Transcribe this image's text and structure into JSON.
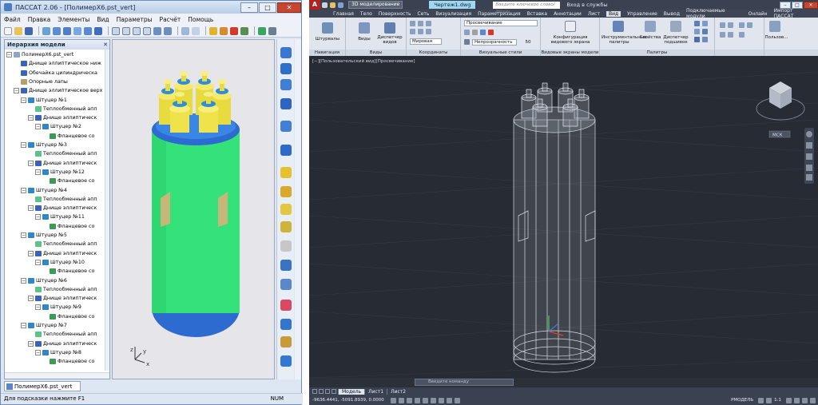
{
  "passat": {
    "title": "ПАССАТ 2.06 - [ПолимерХ6.pst_vert]",
    "menu": [
      "Файл",
      "Правка",
      "Элементы",
      "Вид",
      "Параметры",
      "Расчёт",
      "Помощь"
    ],
    "tree_title": "Иерархия модели",
    "tree": [
      {
        "label": "ПолимерХ6.pst_vert",
        "level": 0,
        "toggle": "−",
        "icon": "#8aa5c8"
      },
      {
        "label": "Днище эллиптическое ниж",
        "level": 1,
        "toggle": "",
        "icon": "#3a63b5"
      },
      {
        "label": "Обечайка цилиндрическа",
        "level": 1,
        "toggle": "",
        "icon": "#3a63b5"
      },
      {
        "label": "Опорные лапы",
        "level": 1,
        "toggle": "",
        "icon": "#b0a070"
      },
      {
        "label": "Днище эллиптическое верх",
        "level": 1,
        "toggle": "−",
        "icon": "#3a63b5"
      },
      {
        "label": "Штуцер №1",
        "level": 2,
        "toggle": "−",
        "icon": "#2f86c9"
      },
      {
        "label": "Теплообменный апп",
        "level": 3,
        "toggle": "",
        "icon": "#5cc28a"
      },
      {
        "label": "Днище эллиптическ",
        "level": 3,
        "toggle": "−",
        "icon": "#3a63b5"
      },
      {
        "label": "Штуцер №2",
        "level": 4,
        "toggle": "−",
        "icon": "#2f86c9"
      },
      {
        "label": "Фланцевое со",
        "level": 5,
        "toggle": "",
        "icon": "#3c9a54"
      },
      {
        "label": "Штуцер №3",
        "level": 2,
        "toggle": "−",
        "icon": "#2f86c9"
      },
      {
        "label": "Теплообменный апп",
        "level": 3,
        "toggle": "",
        "icon": "#5cc28a"
      },
      {
        "label": "Днище эллиптическ",
        "level": 3,
        "toggle": "−",
        "icon": "#3a63b5"
      },
      {
        "label": "Штуцер №12",
        "level": 4,
        "toggle": "−",
        "icon": "#2f86c9"
      },
      {
        "label": "Фланцевое со",
        "level": 5,
        "toggle": "",
        "icon": "#3c9a54"
      },
      {
        "label": "Штуцер №4",
        "level": 2,
        "toggle": "−",
        "icon": "#2f86c9"
      },
      {
        "label": "Теплообменный апп",
        "level": 3,
        "toggle": "",
        "icon": "#5cc28a"
      },
      {
        "label": "Днище эллиптическ",
        "level": 3,
        "toggle": "−",
        "icon": "#3a63b5"
      },
      {
        "label": "Штуцер №11",
        "level": 4,
        "toggle": "−",
        "icon": "#2f86c9"
      },
      {
        "label": "Фланцевое со",
        "level": 5,
        "toggle": "",
        "icon": "#3c9a54"
      },
      {
        "label": "Штуцер №5",
        "level": 2,
        "toggle": "−",
        "icon": "#2f86c9"
      },
      {
        "label": "Теплообменный апп",
        "level": 3,
        "toggle": "",
        "icon": "#5cc28a"
      },
      {
        "label": "Днище эллиптическ",
        "level": 3,
        "toggle": "−",
        "icon": "#3a63b5"
      },
      {
        "label": "Штуцер №10",
        "level": 4,
        "toggle": "−",
        "icon": "#2f86c9"
      },
      {
        "label": "Фланцевое со",
        "level": 5,
        "toggle": "",
        "icon": "#3c9a54"
      },
      {
        "label": "Штуцер №6",
        "level": 2,
        "toggle": "−",
        "icon": "#2f86c9"
      },
      {
        "label": "Теплообменный апп",
        "level": 3,
        "toggle": "",
        "icon": "#5cc28a"
      },
      {
        "label": "Днище эллиптическ",
        "level": 3,
        "toggle": "−",
        "icon": "#3a63b5"
      },
      {
        "label": "Штуцер №9",
        "level": 4,
        "toggle": "−",
        "icon": "#2f86c9"
      },
      {
        "label": "Фланцевое со",
        "level": 5,
        "toggle": "",
        "icon": "#3c9a54"
      },
      {
        "label": "Штуцер №7",
        "level": 2,
        "toggle": "−",
        "icon": "#2f86c9"
      },
      {
        "label": "Теплообменный апп",
        "level": 3,
        "toggle": "",
        "icon": "#5cc28a"
      },
      {
        "label": "Днище эллиптическ",
        "level": 3,
        "toggle": "−",
        "icon": "#3a63b5"
      },
      {
        "label": "Штуцер №8",
        "level": 4,
        "toggle": "−",
        "icon": "#2f86c9"
      },
      {
        "label": "Фланцевое со",
        "level": 5,
        "toggle": "",
        "icon": "#3c9a54"
      }
    ],
    "doc_tab": "ПолимерХ6.pst_vert",
    "status_hint": "Для подсказки нажмите F1",
    "status_num": "NUM",
    "axis_x": "x",
    "axis_y": "y",
    "axis_z": "z",
    "colors": {
      "vessel": "#35e27a",
      "head": "#2e6bd1",
      "nozzle": "#f2e24a",
      "cap": "#2f8fd6"
    }
  },
  "acad": {
    "workspace": "3D моделирование",
    "doc_title": "Чертеж1.dwg",
    "search_placeholder": "Введите ключевое слово/фразу",
    "login": "Вход в службы",
    "tabs": [
      "Главная",
      "Тело",
      "Поверхность",
      "Сеть",
      "Визуализация",
      "Параметризация",
      "Вставка",
      "Аннотации",
      "Лист",
      "Вид",
      "Управление",
      "Вывод",
      "Подключаемые модули",
      "Онлайн",
      "Импорт ПАССАТ"
    ],
    "active_tab": "Вид",
    "ribbon": {
      "nav_btn": "Штурвалы",
      "nav_group": "Навигация",
      "views_btn": "Виды",
      "views_mgr": "Диспетчер видов",
      "views_group": "Виды",
      "coord_field": "Мировая",
      "coord_group": "Координаты",
      "style_field": "Просвечивание",
      "transparency_label": "Непрозрачность",
      "transparency_value": "50",
      "visual_group": "Визуальные стили",
      "viewport_btn": "Конфигурация видового экрана",
      "viewport_group": "Видовые экраны модели",
      "tool_palettes": "Инструментальные палитры",
      "properties": "Свойства",
      "sheet_mgr": "Диспетчер подшивок",
      "palettes_group": "Палитры",
      "user_btn": "Пользов..."
    },
    "viewport_label": "[−][Пользовательский вид][Просвечивание]",
    "viewcube_label": "МСК",
    "cmd_placeholder": "Введите команду",
    "layout_tabs": [
      "Модель",
      "Лист1",
      "Лист2"
    ],
    "active_layout": "Модель",
    "coords": "-9636.4441, -5091.8939, 0.0000",
    "model_label": "РМОДЕЛЬ",
    "scale": "1:1"
  }
}
